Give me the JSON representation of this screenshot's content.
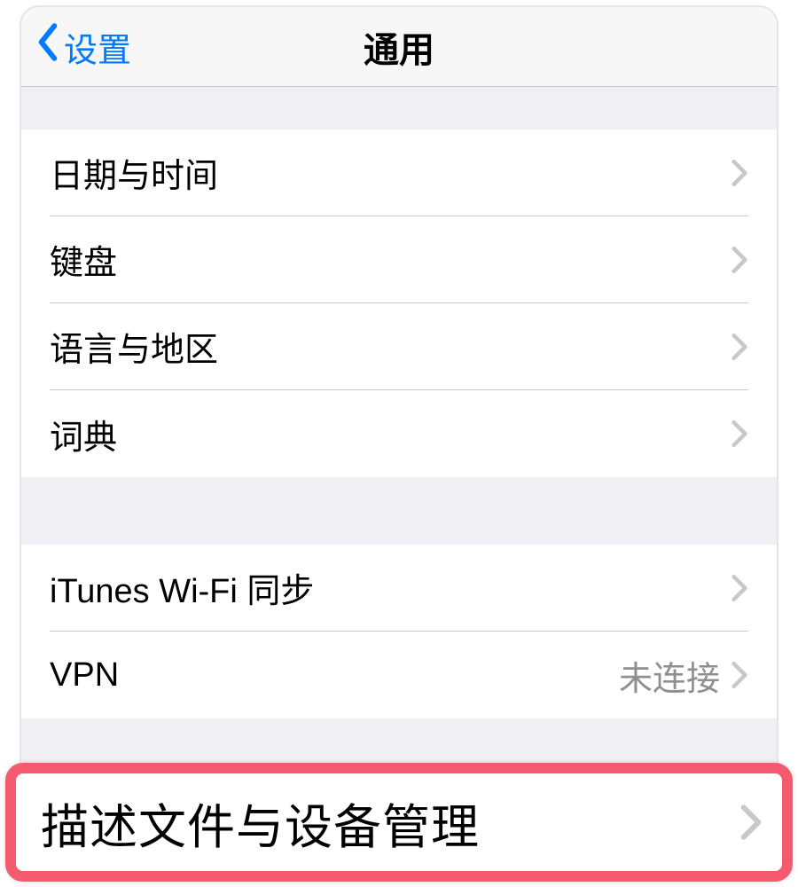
{
  "nav": {
    "back_label": "设置",
    "title": "通用"
  },
  "section1": {
    "items": [
      {
        "label": "日期与时间"
      },
      {
        "label": "键盘"
      },
      {
        "label": "语言与地区"
      },
      {
        "label": "词典"
      }
    ]
  },
  "section2": {
    "items": [
      {
        "label": "iTunes Wi-Fi 同步"
      },
      {
        "label": "VPN",
        "value": "未连接"
      }
    ]
  },
  "highlight": {
    "label": "描述文件与设备管理"
  },
  "colors": {
    "accent": "#007aff",
    "highlight_border": "#f55a6e",
    "disclosure": "#c7c7cc",
    "secondary_text": "#8e8e93",
    "bg": "#efeff4"
  }
}
